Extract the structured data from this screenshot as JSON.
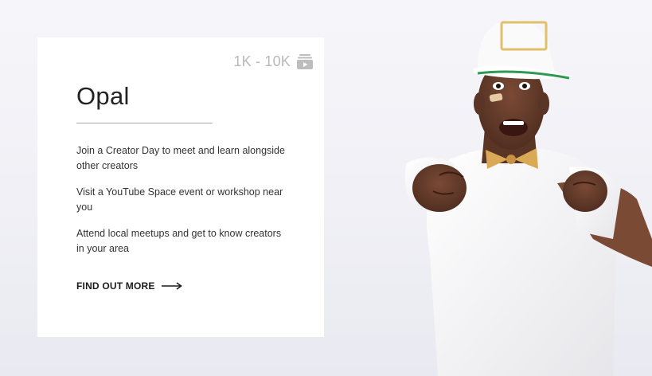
{
  "card": {
    "tier_range": "1K - 10K",
    "tier_icon": "subscriptions-icon",
    "title": "Opal",
    "benefits": [
      "Join a Creator Day to meet and learn alongside other creators",
      "Visit a YouTube Space event or workshop near you",
      "Attend local meetups and get to know creators in your area"
    ],
    "cta_label": "FIND OUT MORE",
    "cta_icon": "arrow-right-icon"
  },
  "colors": {
    "background": "#f0f0f5",
    "card": "#ffffff",
    "tier_text": "#b9b9b9",
    "title": "#222222",
    "body": "#333333",
    "cta": "#1a1a1a",
    "cap": "#ffffff",
    "cap_brim_under": "#2f9a52",
    "cap_badge": "#e0c06a",
    "bow_tie": "#d9a955"
  }
}
